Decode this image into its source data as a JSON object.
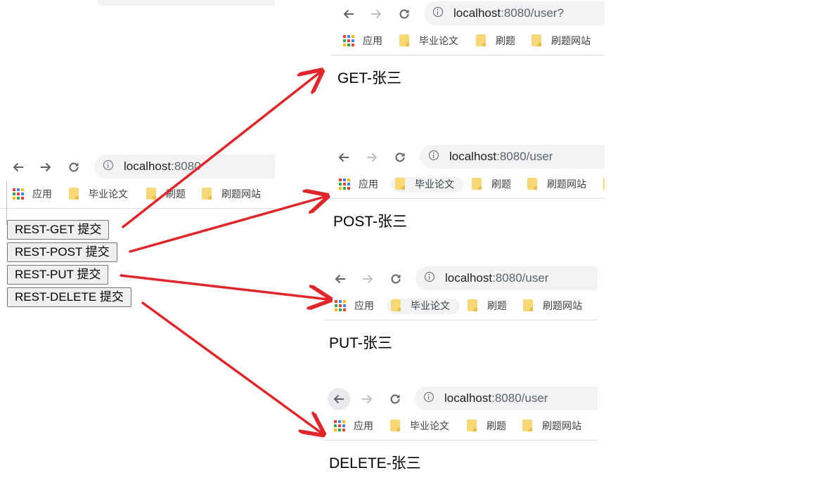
{
  "bookmarks": {
    "apps": "应用",
    "thesis": "毕业论文",
    "practice": "刷题",
    "practice_sites": "刷题网站"
  },
  "form_window": {
    "url_host": "localhost",
    "url_path": ":8080",
    "buttons": {
      "get": "REST-GET 提交",
      "post": "REST-POST 提交",
      "put": "REST-PUT 提交",
      "delete": "REST-DELETE 提交"
    }
  },
  "results": {
    "get": {
      "url_host": "localhost",
      "url_path": ":8080/user?",
      "body_text": "GET-张三"
    },
    "post": {
      "url_host": "localhost",
      "url_path": ":8080/user",
      "body_text": "POST-张三"
    },
    "put": {
      "url_host": "localhost",
      "url_path": ":8080/user",
      "body_text": "PUT-张三"
    },
    "delete": {
      "url_host": "localhost",
      "url_path": ":8080/user",
      "body_text": "DELETE-张三"
    }
  },
  "colors": {
    "arrow": "#e0262b",
    "omnibox": "#f1f3f4",
    "folder": "#f8d775"
  },
  "icons": [
    "back-arrow-icon",
    "forward-arrow-icon",
    "reload-icon",
    "info-icon",
    "apps-grid-icon",
    "folder-icon"
  ]
}
